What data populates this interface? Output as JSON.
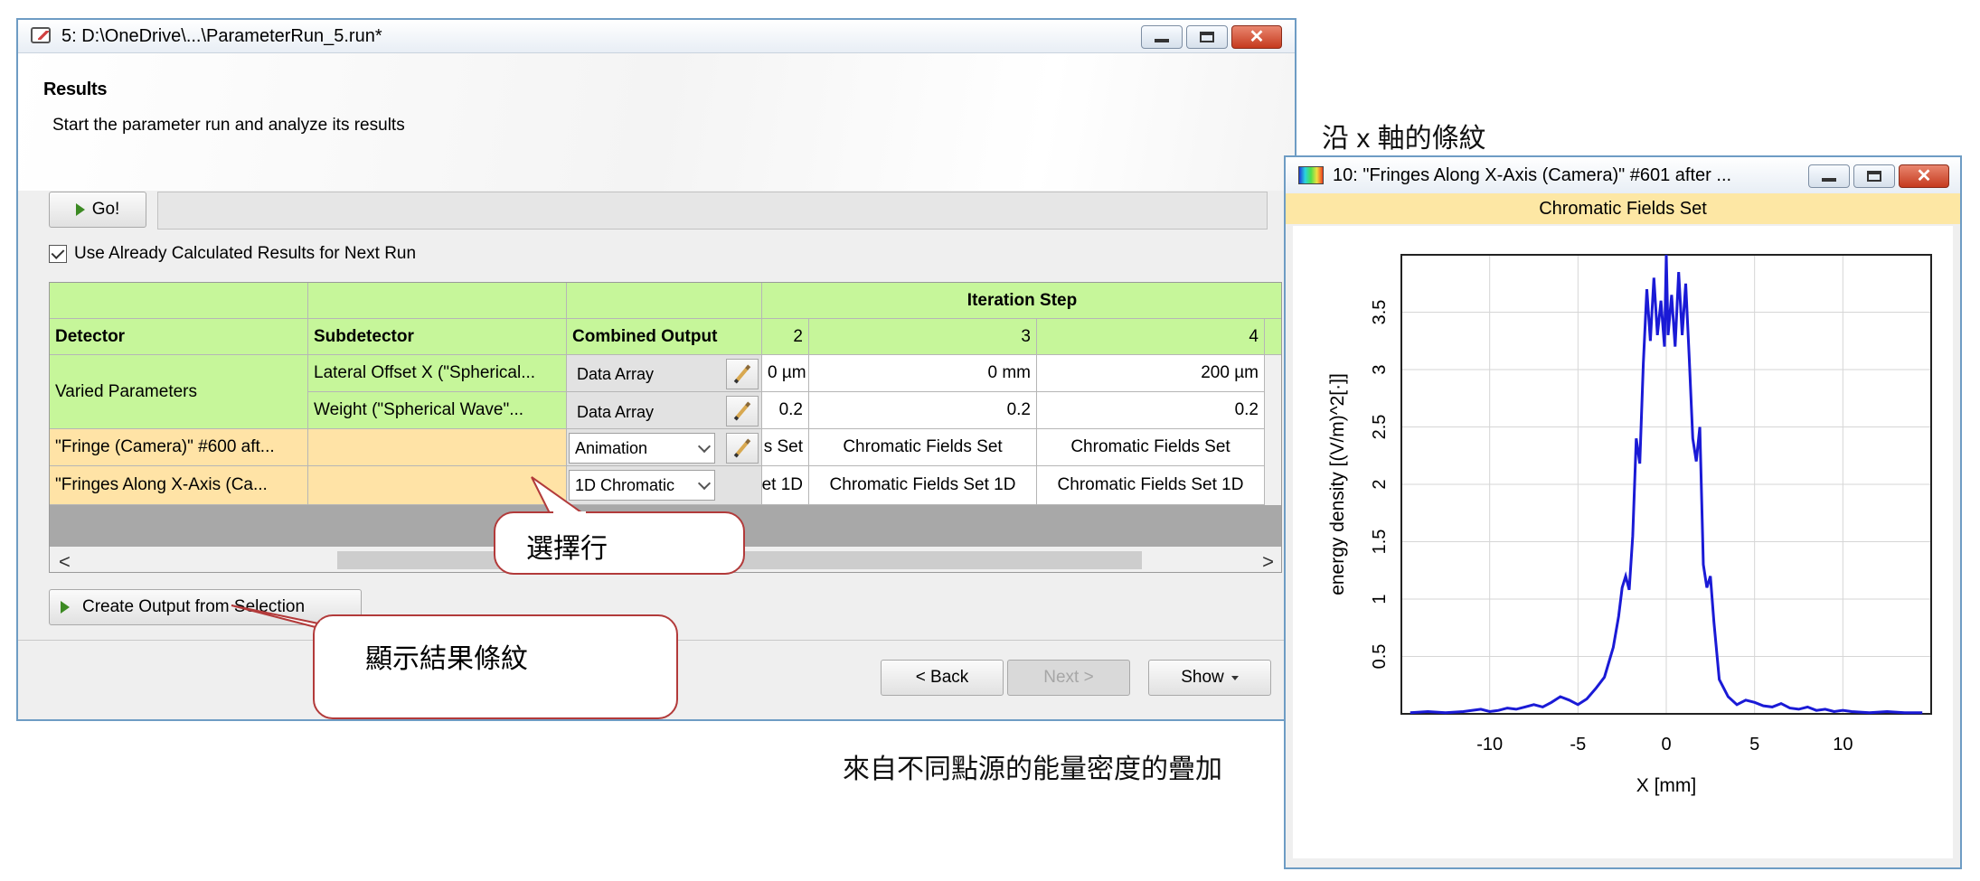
{
  "run_window": {
    "title": "5: D:\\OneDrive\\...\\ParameterRun_5.run*",
    "results_title": "Results",
    "results_subtitle": "Start the parameter run and analyze its results",
    "go_label": "Go!",
    "checkbox_label": "Use Already Calculated Results for Next Run",
    "checkbox_checked": true,
    "create_output_label": "Create Output from Selection",
    "back_label": "< Back",
    "next_label": "Next >",
    "show_label": "Show"
  },
  "grid": {
    "iteration_header": "Iteration Step",
    "headers": {
      "detector": "Detector",
      "subdetector": "Subdetector",
      "combined": "Combined Output",
      "step_a": "2",
      "step_b": "3",
      "step_c": "4"
    },
    "varied_label": "Varied Parameters",
    "rows": [
      {
        "subdetector": "Lateral Offset X (\"Spherical...",
        "output": "Data Array",
        "c2": "0 µm",
        "c3": "0 mm",
        "c4": "200 µm"
      },
      {
        "subdetector": "Weight (\"Spherical Wave\"...",
        "output": "Data Array",
        "c2": "0.2",
        "c3": "0.2",
        "c4": "0.2"
      },
      {
        "detector": "\"Fringe (Camera)\" #600 aft...",
        "subdetector": "",
        "output": "Animation",
        "c2": "s Set",
        "c3": "Chromatic Fields Set",
        "c4": "Chromatic Fields Set"
      },
      {
        "detector": "\"Fringes Along X-Axis (Ca...",
        "subdetector": "",
        "output": "1D Chromatic",
        "c2": "et 1D",
        "c3": "Chromatic Fields Set 1D",
        "c4": "Chromatic Fields Set 1D"
      }
    ],
    "scroll_left": "<",
    "scroll_right": ">"
  },
  "annotations": {
    "select_row": "選擇行",
    "show_fringes": "顯示結果條紋",
    "fringes_x": "沿 x 軸的條紋",
    "superposition": "來自不同點源的能量密度的疊加"
  },
  "plot_window": {
    "title": "10: \"Fringes Along X-Axis (Camera)\" #601 after ...",
    "subtitle": "Chromatic Fields Set"
  },
  "colors": {
    "green_cell": "#c6f69a",
    "orange_cell": "#ffe3a6",
    "callout_border": "#b23a3a",
    "curve": "#1a1ad6"
  },
  "chart_data": {
    "type": "line",
    "title": "",
    "xlabel": "X [mm]",
    "ylabel": "energy density [(V/m)^2[·]]",
    "xlim": [
      -15,
      15
    ],
    "ylim": [
      0,
      4
    ],
    "xticks": [
      -10,
      -5,
      0,
      5,
      10
    ],
    "yticks": [
      0.5,
      1,
      1.5,
      2,
      2.5,
      3,
      3.5
    ],
    "grid": true,
    "series": [
      {
        "x": [
          -14.5,
          -13.5,
          -12.5,
          -11.5,
          -10.5,
          -10,
          -9.5,
          -9,
          -8.5,
          -8,
          -7.5,
          -7,
          -6.5,
          -6,
          -5.5,
          -5,
          -4.5,
          -4,
          -3.5,
          -3,
          -2.7,
          -2.5,
          -2.3,
          -2.1,
          -1.9,
          -1.7,
          -1.5,
          -1.3,
          -1.1,
          -0.9,
          -0.7,
          -0.5,
          -0.3,
          -0.1,
          0,
          0.1,
          0.3,
          0.5,
          0.7,
          0.9,
          1.1,
          1.3,
          1.5,
          1.7,
          1.9,
          2.1,
          2.3,
          2.5,
          2.7,
          3,
          3.5,
          4,
          4.5,
          5,
          5.5,
          6,
          6.5,
          7,
          7.5,
          8,
          8.5,
          9,
          9.5,
          10,
          10.5,
          11.5,
          12.5,
          13.5,
          14.5
        ],
        "y": [
          0.01,
          0.02,
          0.01,
          0.02,
          0.04,
          0.02,
          0.03,
          0.05,
          0.04,
          0.06,
          0.08,
          0.06,
          0.1,
          0.15,
          0.12,
          0.08,
          0.13,
          0.22,
          0.32,
          0.58,
          0.85,
          1.1,
          1.2,
          1.08,
          1.55,
          2.4,
          2.18,
          3.05,
          3.7,
          3.25,
          3.8,
          3.3,
          3.6,
          3.2,
          4.0,
          3.3,
          3.65,
          3.2,
          3.85,
          3.3,
          3.75,
          3.1,
          2.4,
          2.2,
          2.5,
          1.3,
          1.1,
          1.2,
          0.8,
          0.3,
          0.15,
          0.08,
          0.12,
          0.1,
          0.07,
          0.06,
          0.09,
          0.05,
          0.04,
          0.06,
          0.03,
          0.04,
          0.02,
          0.03,
          0.02,
          0.01,
          0.02,
          0.01,
          0.01
        ]
      }
    ]
  }
}
